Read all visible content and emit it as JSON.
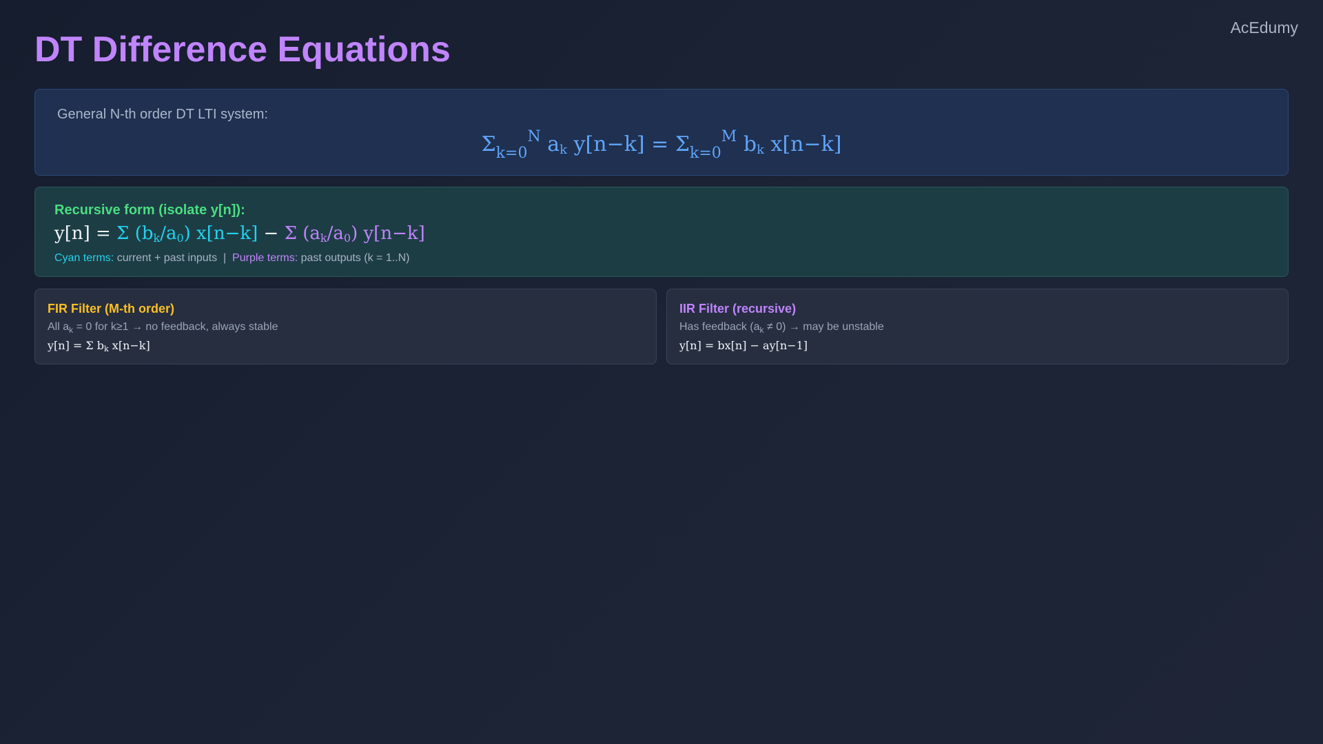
{
  "brand": "AcEdumy",
  "title": "DT Difference Equations",
  "general": {
    "label": "General N-th order DT LTI system:",
    "eq_sigma1": "Σ",
    "eq_sub1": "k=0",
    "eq_sup1": "N",
    "eq_a": " a",
    "eq_a_sub": "k",
    "eq_lhs_tail": " y[n−k] = ",
    "eq_sigma2": "Σ",
    "eq_sub2": "k=0",
    "eq_sup2": "M",
    "eq_b": " b",
    "eq_b_sub": "k",
    "eq_rhs_tail": " x[n−k]"
  },
  "recursive": {
    "label": "Recursive form (isolate y[n]):",
    "eq_lhs": "y[n] = ",
    "cyan_1": "Σ (b",
    "cyan_sub1": "k",
    "cyan_2": "/a",
    "cyan_sub2": "0",
    "cyan_3": ") x[n−k]",
    "minus": " − ",
    "purple_1": "Σ (a",
    "purple_sub1": "k",
    "purple_2": "/a",
    "purple_sub2": "0",
    "purple_3": ") y[n−k]",
    "legend_cyan_label": "Cyan terms:",
    "legend_cyan_text": " current + past inputs  |  ",
    "legend_purple_label": "Purple terms:",
    "legend_purple_text": " past outputs (k = 1..N)"
  },
  "fir": {
    "title": "FIR Filter (M-th order)",
    "desc_1": "All a",
    "desc_sub": "k",
    "desc_2": " = 0 for k≥1 → no feedback, always stable",
    "eq_1": "y[n] = Σ b",
    "eq_sub": "k",
    "eq_2": " x[n−k]"
  },
  "iir": {
    "title": "IIR Filter (recursive)",
    "desc_1": "Has feedback (a",
    "desc_sub": "k",
    "desc_2": " ≠ 0) → may be unstable",
    "eq": "y[n] = bx[n] − ay[n−1]"
  },
  "colors": {
    "title": "#c084fc",
    "general_eq": "#60a5fa",
    "recursive_label": "#4ade80",
    "cyan": "#22d3ee",
    "purple": "#c084fc",
    "fir_title": "#fbbf24",
    "iir_title": "#c084fc"
  }
}
